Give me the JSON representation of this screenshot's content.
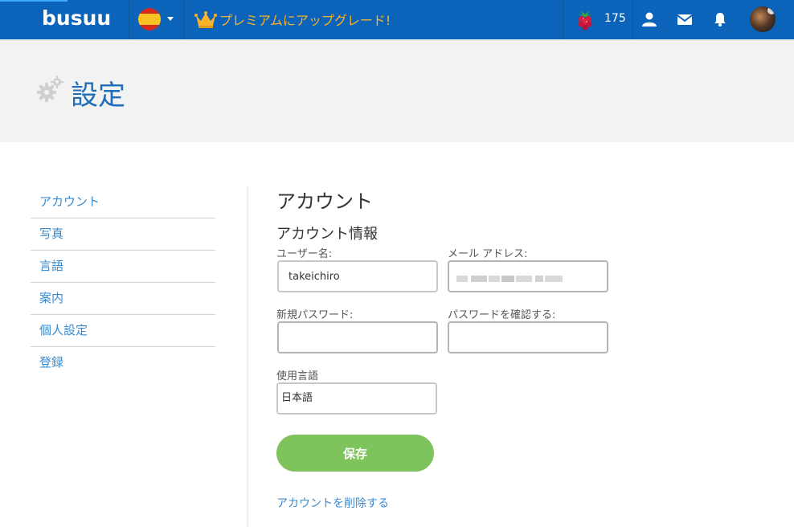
{
  "header": {
    "logo": "busuu",
    "premium_label": "プレミアムにアップグレード!",
    "points": "175"
  },
  "page": {
    "title": "設定"
  },
  "sidebar": {
    "items": [
      {
        "label": "アカウント"
      },
      {
        "label": "写真"
      },
      {
        "label": "言語"
      },
      {
        "label": "案内"
      },
      {
        "label": "個人設定"
      },
      {
        "label": "登録"
      }
    ]
  },
  "account": {
    "section_title": "アカウント",
    "info_title": "アカウント情報",
    "username_label": "ユーザー名:",
    "username_value": "takeichiro",
    "email_label": "メール アドレス:",
    "new_password_label": "新規パスワード:",
    "confirm_password_label": "パスワードを確認する:",
    "language_label": "使用言語",
    "language_value": "日本語",
    "save_label": "保存",
    "delete_label": "アカウントを削除する"
  },
  "colors": {
    "topbar": "#0b63ba",
    "accent_blue": "#1e6db6",
    "link_blue": "#3a8bd0",
    "premium_gold": "#f7b32b",
    "save_green": "#7fc35c"
  },
  "icons": [
    "spain-flag-icon",
    "chevron-down-icon",
    "crown-icon",
    "raspberry-icon",
    "user-icon",
    "mail-icon",
    "bell-icon",
    "gear-icon"
  ]
}
